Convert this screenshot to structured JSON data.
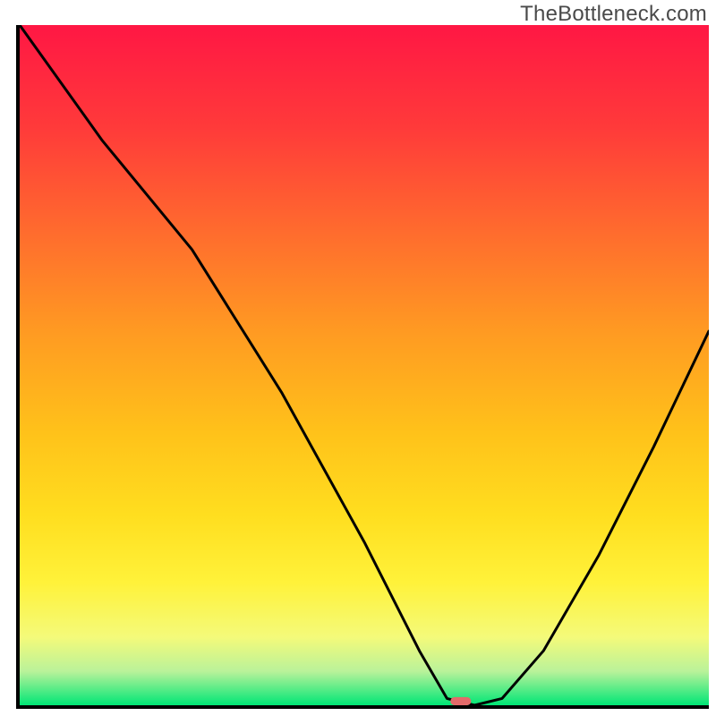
{
  "watermark": "TheBottleneck.com",
  "chart_data": {
    "type": "line",
    "title": "",
    "xlabel": "",
    "ylabel": "",
    "xlim": [
      0,
      100
    ],
    "ylim": [
      0,
      100
    ],
    "x": [
      0,
      12,
      25,
      38,
      50,
      58,
      62,
      66,
      70,
      76,
      84,
      92,
      100
    ],
    "values": [
      100,
      83,
      67,
      46,
      24,
      8,
      1,
      0,
      1,
      8,
      22,
      38,
      55
    ],
    "marker": {
      "x": 64,
      "y": 0,
      "w": 3,
      "h": 1.2,
      "color": "#e46a6a"
    },
    "gradient_bands": [
      {
        "y0": 100,
        "y1": 85,
        "fill": "#ff1744"
      },
      {
        "y0": 85,
        "y1": 70,
        "fill": "#ff5436"
      },
      {
        "y0": 70,
        "y1": 55,
        "fill": "#ff8a2a"
      },
      {
        "y0": 55,
        "y1": 40,
        "fill": "#ffb21f"
      },
      {
        "y0": 40,
        "y1": 28,
        "fill": "#ffd21a"
      },
      {
        "y0": 28,
        "y1": 18,
        "fill": "#ffe82a"
      },
      {
        "y0": 18,
        "y1": 10,
        "fill": "#f7f55a"
      },
      {
        "y0": 10,
        "y1": 4,
        "fill": "#c9f084"
      },
      {
        "y0": 4,
        "y1": 0,
        "fill": "#00e676"
      }
    ]
  }
}
